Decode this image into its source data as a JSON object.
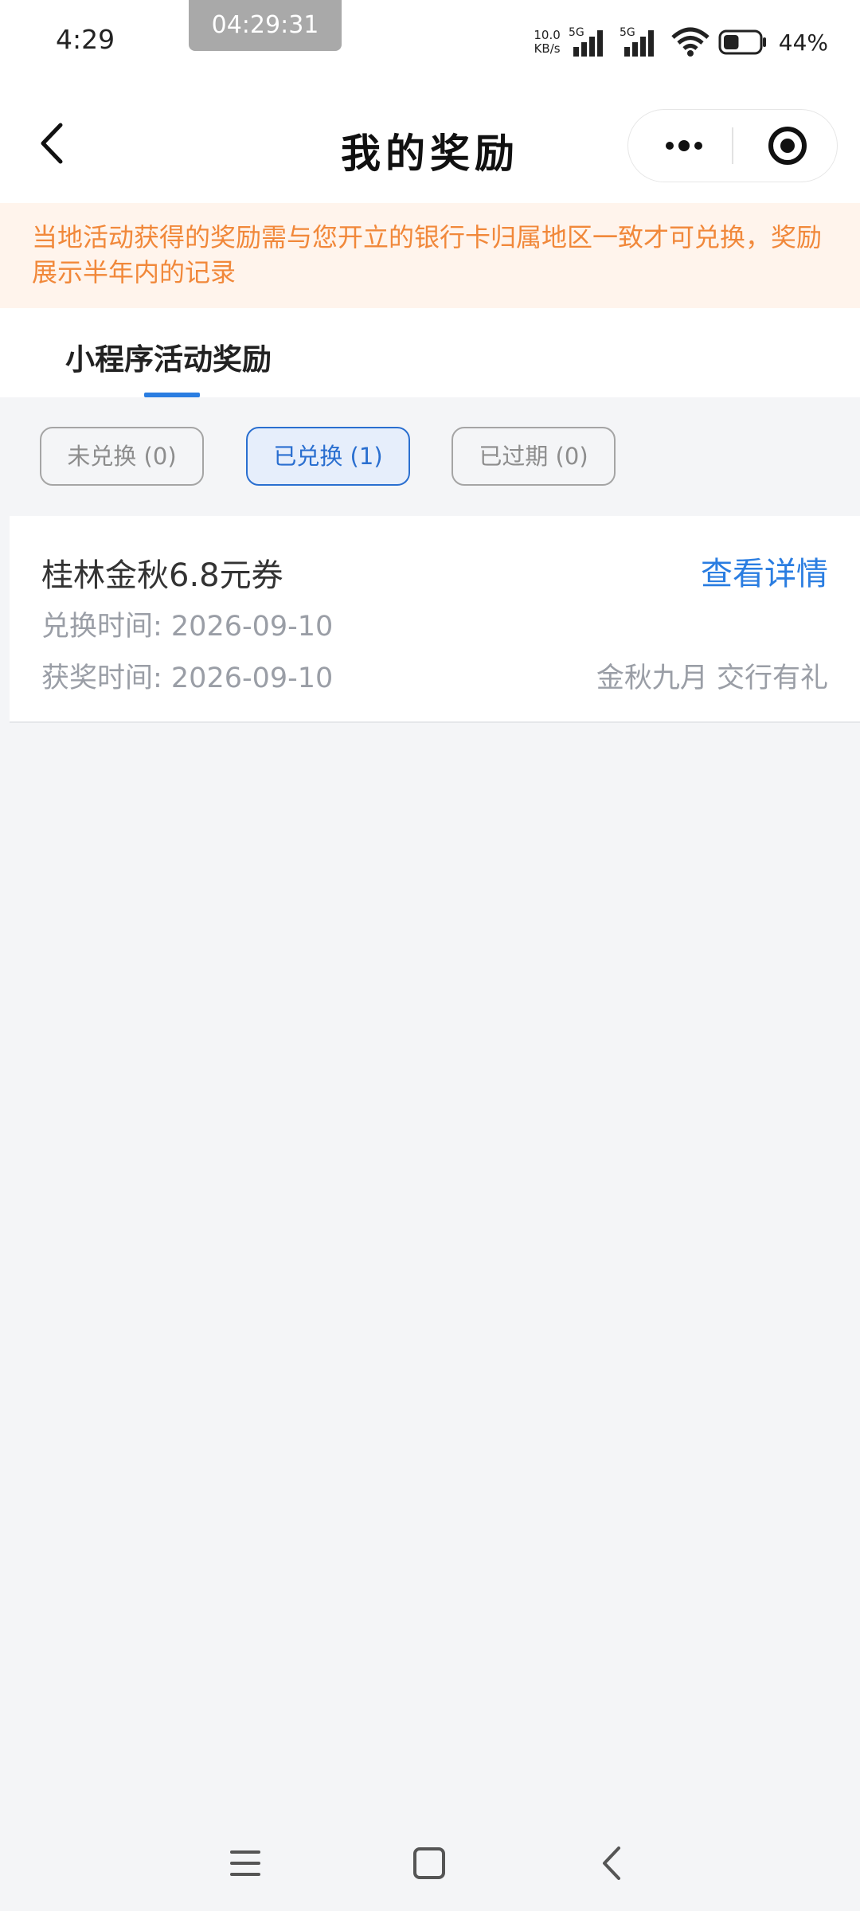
{
  "status_bar": {
    "time": "4:29",
    "recording_time": "04:29:31",
    "net_speed_value": "10.0",
    "net_speed_unit": "KB/s",
    "signal1_label": "5G",
    "signal2_label": "5G",
    "battery_percent": "44%",
    "battery_level": 0.44
  },
  "header": {
    "title": "我的奖励",
    "icons": [
      "back-icon",
      "more-icon",
      "target-icon"
    ]
  },
  "notice": {
    "text": "当地活动获得的奖励需与您开立的银行卡归属地区一致才可兑换，奖励展示半年内的记录",
    "color": "#f1883a"
  },
  "tabs": [
    {
      "label": "小程序活动奖励",
      "active": true
    }
  ],
  "filters": [
    {
      "label": "未兑换 (0)",
      "active": false
    },
    {
      "label": "已兑换 (1)",
      "active": true
    },
    {
      "label": "已过期 (0)",
      "active": false
    }
  ],
  "rewards": [
    {
      "title": "桂林金秋6.8元券",
      "detail_link": "查看详情",
      "redeem_time": "兑换时间: 2026-09-10",
      "award_time": "获奖时间: 2026-09-10",
      "activity": "金秋九月 交行有礼"
    }
  ],
  "accent_color": "#2a7de1",
  "nav_bar": {
    "icons": [
      "menu-icon",
      "home-icon",
      "back-nav-icon"
    ]
  }
}
